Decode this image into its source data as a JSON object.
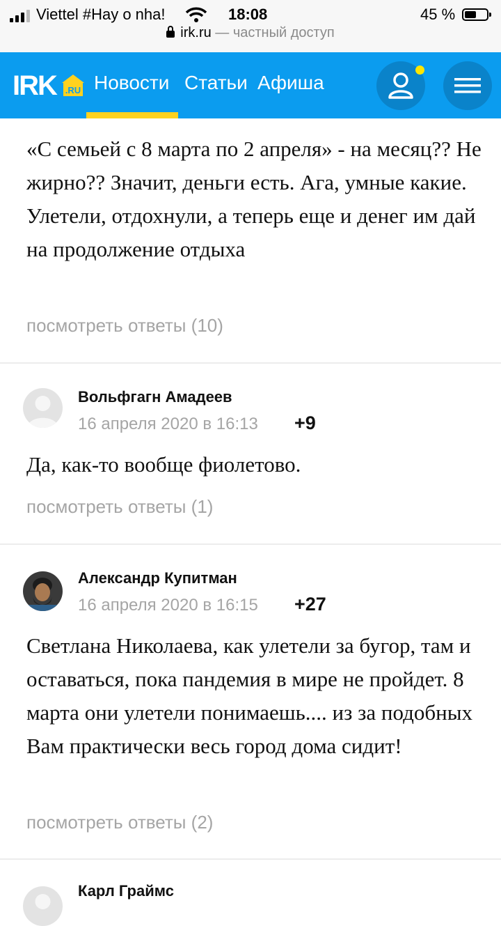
{
  "status_bar": {
    "carrier": "Viettel #Hay o nha!",
    "time": "18:08",
    "battery": "45 %",
    "battery_level": 0.45
  },
  "url_bar": {
    "domain": "irk.ru",
    "subtitle": " — частный доступ"
  },
  "nav": {
    "logo_text": "IRK",
    "logo_sub": ".RU",
    "links": [
      "Новости",
      "Статьи",
      "Афиша"
    ],
    "active_link": "Новости"
  },
  "comments": [
    {
      "text": "«С семьей с 8 марта по 2 апреля» - на месяц?? Не жирно?? Значит, деньги есть. Ага, умные какие. Улетели, отдохнули, а теперь еще и денег им дай на продолжение отдыха",
      "replies": "посмотреть ответы (10)"
    },
    {
      "author": "Вольфгагн Амадеев",
      "date": "16 апреля 2020 в 16:13",
      "score": "+9",
      "text": "Да, как-то вообще фиолетово.",
      "replies": "посмотреть ответы (1)"
    },
    {
      "author": "Александр Купитман",
      "date": "16 апреля 2020 в 16:15",
      "score": "+27",
      "text": "Светлана Николаева, как улетели за бугор, там и оставаться, пока пандемия в мире не пройдет. 8 марта они улетели понимаешь.... из за подобных Вам практически весь город дома сидит!",
      "replies": "посмотреть ответы (2)"
    },
    {
      "author": "Карл Граймс"
    }
  ],
  "colors": {
    "nav_bg": "#0b9cef",
    "accent": "#ffd21f",
    "muted": "#a5a5a5"
  }
}
